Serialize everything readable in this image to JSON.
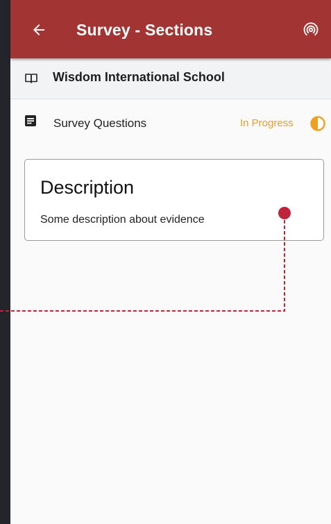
{
  "header": {
    "title": "Survey - Sections",
    "back_icon": "arrow-back-icon",
    "cast_icon": "broadcast-icon",
    "color": "#a23533"
  },
  "school": {
    "icon": "book-icon",
    "name": "Wisdom International School"
  },
  "sections": [
    {
      "icon": "document-icon",
      "label": "Survey Questions",
      "status": "In Progress",
      "status_icon": "half-circle-progress-icon",
      "status_color": "#e4a01e"
    }
  ],
  "description_card": {
    "title": "Description",
    "text": "Some description about evidence"
  },
  "annotation": {
    "type": "dashed-pointer",
    "color": "#c0243a"
  }
}
